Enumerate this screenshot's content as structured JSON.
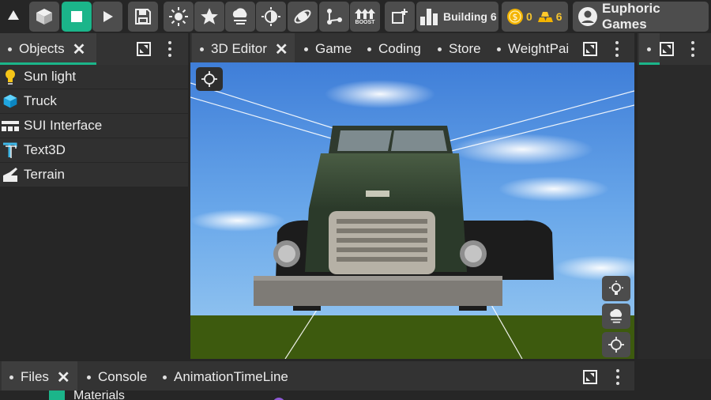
{
  "toolbar": {
    "building_label": "Building 6",
    "coins": "0",
    "gold": "6",
    "user_name": "Euphoric Games",
    "boost_label": "BOOST"
  },
  "objects_panel": {
    "tab_label": "Objects",
    "items": [
      {
        "label": "Sun light",
        "icon": "bulb-icon"
      },
      {
        "label": "Truck",
        "icon": "cube-icon"
      },
      {
        "label": "SUI Interface",
        "icon": "ui-layout-icon"
      },
      {
        "label": "Text3D",
        "icon": "text3d-icon"
      },
      {
        "label": "Terrain",
        "icon": "terrain-icon"
      }
    ]
  },
  "editor_tabs": [
    "3D Editor",
    "Game",
    "Coding",
    "Store",
    "WeightPai"
  ],
  "bottom_tabs": [
    "Files",
    "Console",
    "AnimationTimeLine"
  ],
  "files": {
    "first_item": "Materials"
  },
  "colors": {
    "accent": "#1bb58a",
    "toolbar_button": "#4d4d4d",
    "panel": "#333333",
    "grass": "#3d5a0e"
  }
}
